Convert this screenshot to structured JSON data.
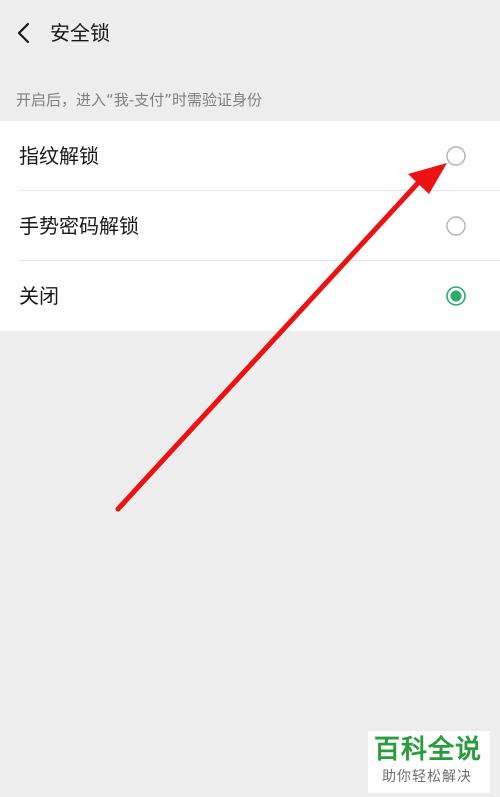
{
  "header": {
    "back_icon": "chevron-left-icon",
    "title": "安全锁"
  },
  "hint": "开启后，进入“我-支付”时需验证身份",
  "options": [
    {
      "label": "指纹解锁",
      "selected": false
    },
    {
      "label": "手势密码解锁",
      "selected": false
    },
    {
      "label": "关闭",
      "selected": true
    }
  ],
  "annotation": {
    "icon": "red-arrow-icon",
    "color": "#ee1111"
  },
  "watermark": {
    "main": "百科全说",
    "sub": "助你轻松解决"
  },
  "colors": {
    "accent": "#2aae67",
    "background": "#ededed",
    "radio_off": "#b2b2b2"
  }
}
